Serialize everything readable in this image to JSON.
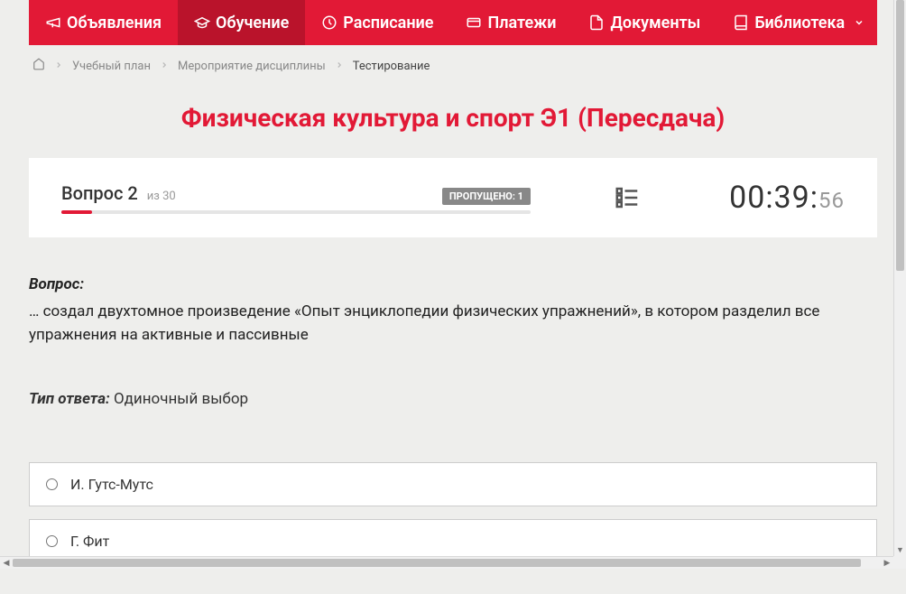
{
  "nav": {
    "items": [
      {
        "label": "Объявления",
        "icon": "megaphone-icon",
        "active": false
      },
      {
        "label": "Обучение",
        "icon": "graduation-cap-icon",
        "active": true
      },
      {
        "label": "Расписание",
        "icon": "clock-icon",
        "active": false
      },
      {
        "label": "Платежи",
        "icon": "payment-icon",
        "active": false
      },
      {
        "label": "Документы",
        "icon": "document-icon",
        "active": false
      },
      {
        "label": "Библиотека",
        "icon": "book-icon",
        "active": false,
        "dropdown": true
      }
    ]
  },
  "breadcrumb": {
    "items": [
      {
        "label": "Учебный план"
      },
      {
        "label": "Мероприятие дисциплины"
      },
      {
        "label": "Тестирование",
        "current": true
      }
    ]
  },
  "page_title": "Физическая культура и спорт Э1 (Пересдача)",
  "status": {
    "question_label": "Вопрос 2",
    "total_label": "из 30",
    "skipped_label": "ПРОПУЩЕНО: 1",
    "timer_main": "00:39:",
    "timer_sec": "56"
  },
  "question": {
    "label": "Вопрос:",
    "text": "… создал двухтомное произведение «Опыт энциклопедии физических упражнений», в котором разделил все упражнения на активные и пассивные",
    "answer_type_label": "Тип ответа:",
    "answer_type_value": "Одиночный выбор",
    "options": [
      {
        "text": "И. Гутс-Мутс"
      },
      {
        "text": "Г. Фит"
      }
    ]
  }
}
